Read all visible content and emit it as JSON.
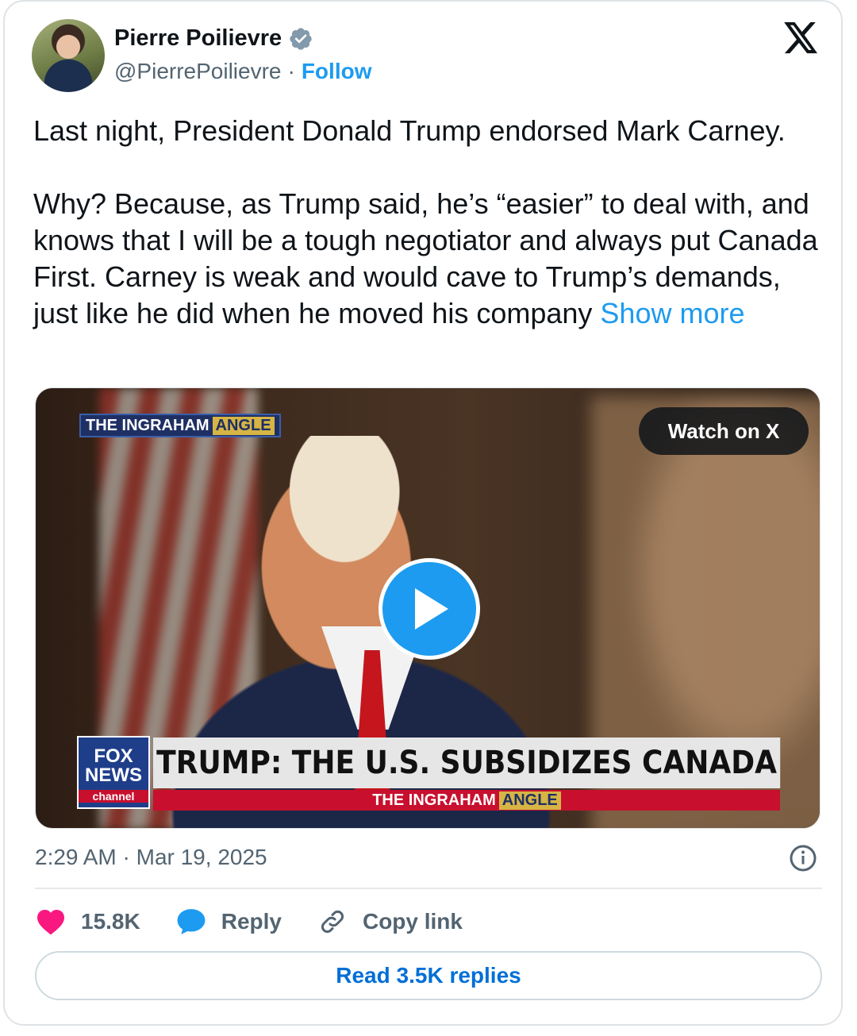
{
  "author": {
    "name": "Pierre Poilievre",
    "handle": "@PierrePoilievre",
    "separator": "·",
    "follow_label": "Follow",
    "verified_icon": "verified-badge-icon"
  },
  "tweet": {
    "paragraph1": "Last night, President Donald Trump endorsed Mark Carney.",
    "paragraph2": "Why? Because, as Trump said, he’s “easier” to deal with, and knows that I will be a tough negotiator and always put Canada First. Carney is weak and would cave to Trump’s demands, just like he did when he moved his company",
    "show_more": "Show more"
  },
  "video": {
    "show_name": "THE INGRAHAM",
    "show_angle": "ANGLE",
    "watch_label": "Watch on X",
    "network_line1": "FOX",
    "network_line2": "NEWS",
    "network_line3": "channel",
    "headline": "TRUMP: THE U.S. SUBSIDIZES CANADA",
    "sub_show_name": "THE INGRAHAM",
    "sub_show_angle": "ANGLE"
  },
  "meta": {
    "timestamp": "2:29 AM · Mar 19, 2025"
  },
  "actions": {
    "likes": "15.8K",
    "reply_label": "Reply",
    "copy_label": "Copy link"
  },
  "footer": {
    "read_replies": "Read 3.5K replies"
  },
  "colors": {
    "accent": "#1d9bf0",
    "like": "#f91880",
    "text_secondary": "#536471"
  }
}
